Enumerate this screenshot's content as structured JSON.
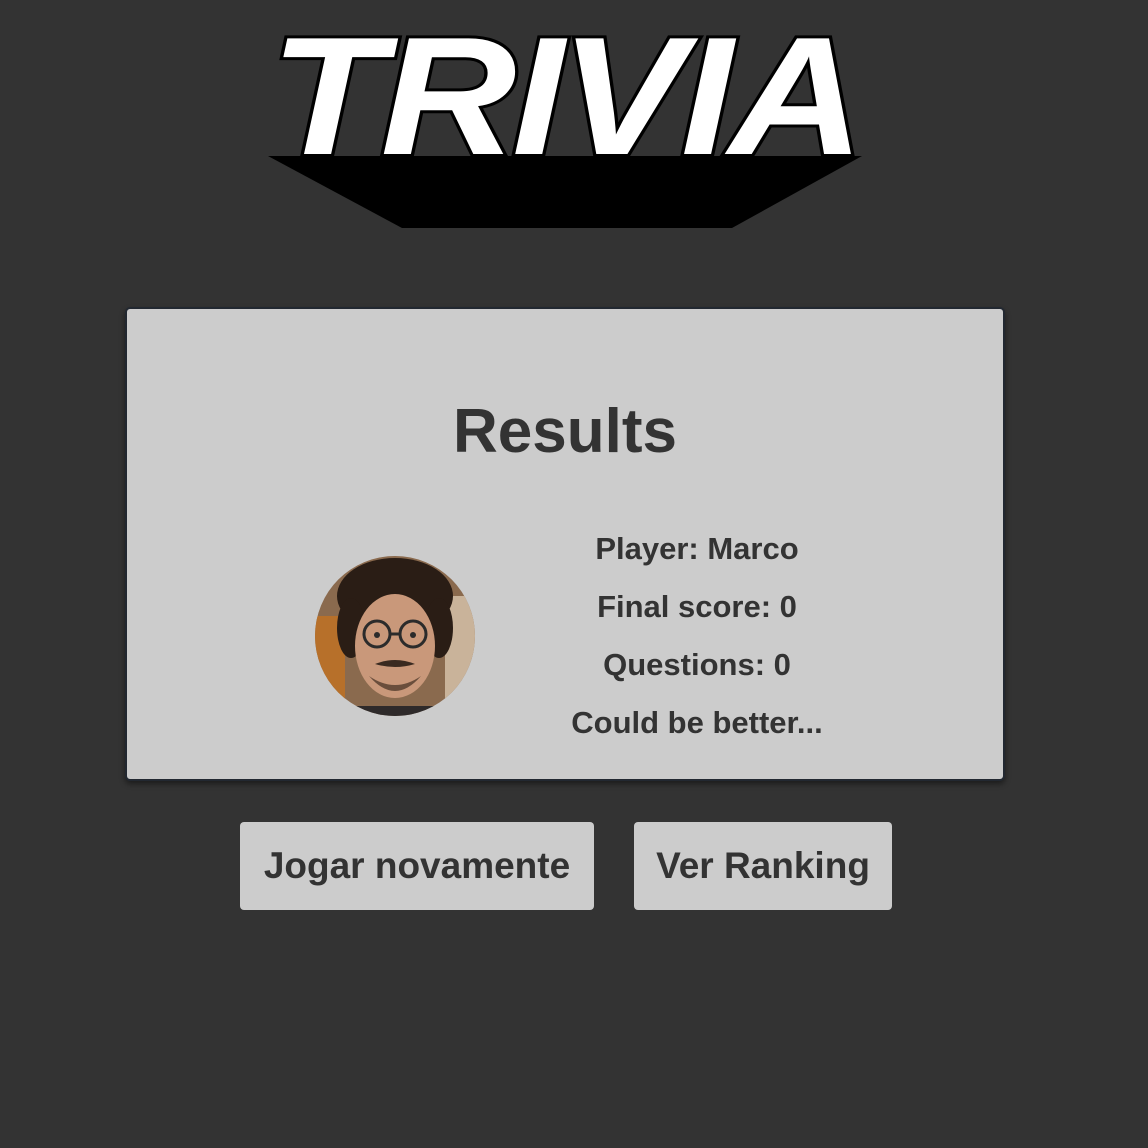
{
  "logo": {
    "text": "TRIVIA"
  },
  "results": {
    "title": "Results",
    "player_line": "Player: Marco",
    "score_line": "Final score: 0",
    "questions_line": "Questions: 0",
    "feedback_line": "Could be better..."
  },
  "actions": {
    "play_again_label": "Jogar novamente",
    "ranking_label": "Ver Ranking"
  },
  "colors": {
    "background": "#333333",
    "card": "#cccccc",
    "text": "#333333",
    "button": "#cccccc"
  }
}
